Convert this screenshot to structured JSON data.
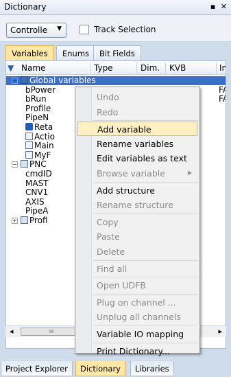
{
  "titlebar": {
    "title": "Dictionary",
    "pin_icon": "pin-icon",
    "close_icon": "close-icon",
    "pin": "▪",
    "close": "✕"
  },
  "toolbar": {
    "dropdown_value": "Controlle",
    "dropdown_arrow": "▼",
    "checkbox_label": "Track Selection"
  },
  "tabs": [
    "Variables",
    "Enums",
    "Bit Fields"
  ],
  "grid": {
    "headers": [
      "Name",
      "Type",
      "Dim.",
      "KVB",
      "In"
    ],
    "rows": [
      {
        "indent": 0,
        "expander": "−",
        "icon": "global",
        "name": "Global variables",
        "type": "",
        "extra": ""
      },
      {
        "indent": 1,
        "expander": "",
        "icon": "",
        "name": "bPower",
        "type": "",
        "extra": "FA"
      },
      {
        "indent": 1,
        "expander": "",
        "icon": "",
        "name": "bRun",
        "type": "",
        "extra": "FA"
      },
      {
        "indent": 1,
        "expander": "",
        "icon": "",
        "name": "Profile",
        "type": "",
        "extra": ""
      },
      {
        "indent": 1,
        "expander": "",
        "icon": "",
        "name": "PipeN",
        "type": "",
        "extra": ""
      },
      {
        "indent": 1,
        "expander": "",
        "icon": "retain",
        "name": "Reta",
        "type": "",
        "extra": ""
      },
      {
        "indent": 1,
        "expander": "",
        "icon": "doc",
        "name": "Actio",
        "type": "",
        "extra": ""
      },
      {
        "indent": 1,
        "expander": "",
        "icon": "doc",
        "name": "Main",
        "type": "",
        "extra": ""
      },
      {
        "indent": 1,
        "expander": "",
        "icon": "doc",
        "name": "MyF",
        "type": "",
        "extra": ""
      },
      {
        "indent": 0,
        "expander": "−",
        "icon": "pnc",
        "name": "PNC",
        "type": "",
        "extra": ""
      },
      {
        "indent": 1,
        "expander": "",
        "icon": "",
        "name": "cmdID",
        "type": "",
        "extra": ""
      },
      {
        "indent": 1,
        "expander": "",
        "icon": "",
        "name": "MAST",
        "type": "",
        "extra": ""
      },
      {
        "indent": 1,
        "expander": "",
        "icon": "",
        "name": "CNV1",
        "type": "",
        "extra": ""
      },
      {
        "indent": 1,
        "expander": "",
        "icon": "",
        "name": "AXIS",
        "type": "",
        "extra": ""
      },
      {
        "indent": 1,
        "expander": "",
        "icon": "",
        "name": "PipeA",
        "type": "",
        "extra": ""
      },
      {
        "indent": 0,
        "expander": "+",
        "icon": "pnc",
        "name": "Profi",
        "type": "",
        "extra": ""
      }
    ]
  },
  "context_menu": {
    "items": [
      {
        "label": "Undo",
        "disabled": true
      },
      {
        "label": "Redo",
        "disabled": true
      },
      {
        "sep": true
      },
      {
        "label": "Add variable",
        "disabled": false,
        "hover": true
      },
      {
        "label": "Rename variables",
        "disabled": false
      },
      {
        "label": "Edit variables as text",
        "disabled": false
      },
      {
        "label": "Browse variable",
        "disabled": true,
        "submenu": true
      },
      {
        "sep": true
      },
      {
        "label": "Add structure",
        "disabled": false
      },
      {
        "label": "Rename structure",
        "disabled": true
      },
      {
        "sep": true
      },
      {
        "label": "Copy",
        "disabled": true
      },
      {
        "label": "Paste",
        "disabled": true
      },
      {
        "label": "Delete",
        "disabled": true
      },
      {
        "sep": true
      },
      {
        "label": "Find all",
        "disabled": true
      },
      {
        "sep": true
      },
      {
        "label": "Open UDFB",
        "disabled": true
      },
      {
        "sep": true
      },
      {
        "label": "Plug on channel ...",
        "disabled": true
      },
      {
        "label": "Unplug all channels",
        "disabled": true
      },
      {
        "sep": true
      },
      {
        "label": "Variable IO mapping",
        "disabled": false
      },
      {
        "sep": true
      },
      {
        "label": "Print Dictionary...",
        "disabled": false
      }
    ]
  },
  "scrollbar": {
    "left_arrow": "◂",
    "thumb": "III",
    "right_arrow": "▸"
  },
  "bottom_tabs": [
    "Project Explorer",
    "Dictionary",
    "Libraries"
  ]
}
